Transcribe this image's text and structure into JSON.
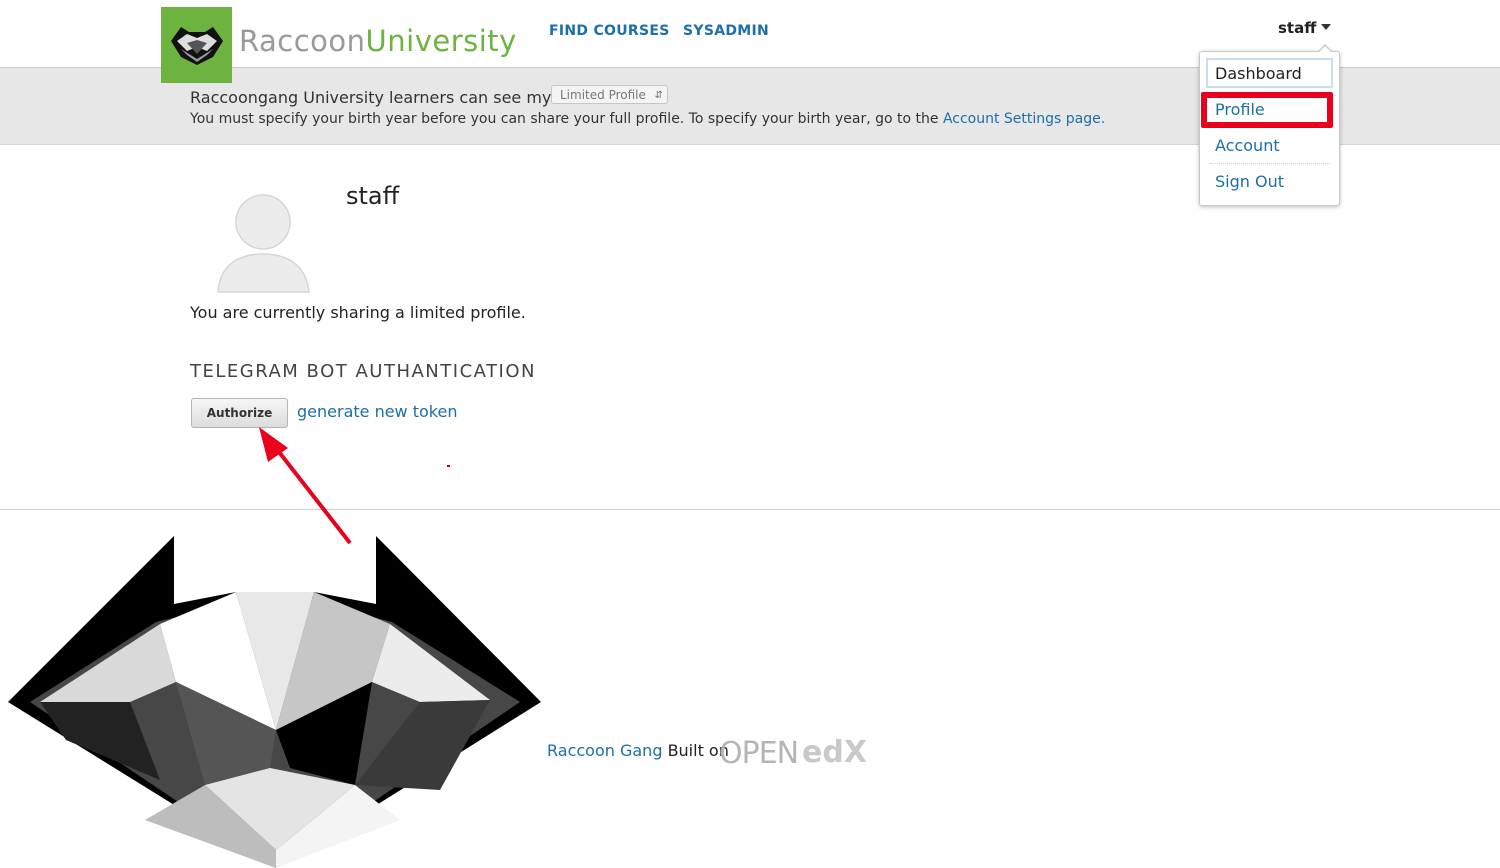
{
  "header": {
    "logo": {
      "part1": "Raccoon",
      "part2": "University",
      "box_color": "#6cb33f"
    },
    "nav": [
      {
        "label": "FIND COURSES"
      },
      {
        "label": "SYSADMIN"
      }
    ],
    "user": {
      "name": "staff"
    }
  },
  "dropdown": {
    "items": [
      {
        "label": "Dashboard"
      },
      {
        "label": "Profile"
      },
      {
        "label": "Account"
      },
      {
        "label": "Sign Out"
      }
    ],
    "highlight_color": "#e8001c"
  },
  "privacy": {
    "label": "Raccoongang University learners can see my:",
    "selected": "Limited Profile",
    "note": "You must specify your birth year before you can share your full profile. To specify your birth year, go to the",
    "note_link": "Account Settings page."
  },
  "profile": {
    "username": "staff",
    "message": "You are currently sharing a limited profile."
  },
  "telegram": {
    "title": "TELEGRAM BOT AUTHANTICATION",
    "authorize_label": "Authorize",
    "token_link": "generate new token"
  },
  "footer": {
    "company": "Raccoon Gang",
    "built_on": "Built on",
    "platform_logo": "OPENedX"
  },
  "colors": {
    "link": "#1c6fa8",
    "annotation": "#e8001c"
  }
}
